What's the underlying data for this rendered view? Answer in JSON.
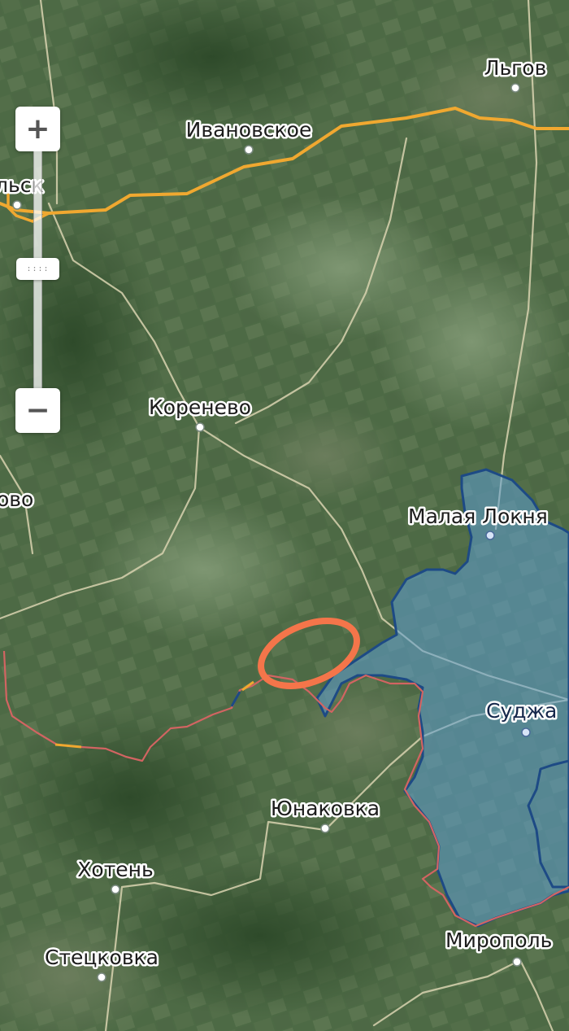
{
  "map": {
    "colors": {
      "highway": "#f0a830",
      "secondary_road": "#d9d3b0",
      "border_line": "#d26462",
      "controlled_fill": "#5f9fd2",
      "controlled_edge": "#1d4a85",
      "marker": "#f4754a"
    },
    "places": {
      "lgov": "Льгов",
      "ivanovskoe": "Ивановское",
      "rylsk": "льск",
      "korenevo": "Коренево",
      "ovo": "ово",
      "malaya_loknya": "Малая Локня",
      "sudzha": "Суджа",
      "yunakovka": "Юнаковка",
      "khoten": "Хотень",
      "stetskovka": "Стецковка",
      "miropolye": "Мирополь"
    }
  },
  "zoom_control": {
    "plus_icon": "+",
    "minus_icon": "−",
    "handle_icon": "::::"
  }
}
